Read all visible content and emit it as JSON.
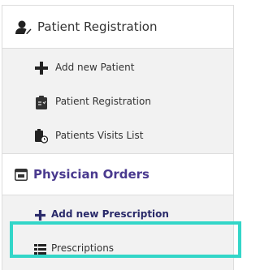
{
  "patient_registration": {
    "title": "Patient Registration",
    "icon": "user-icon",
    "items": [
      {
        "label": "Add new Patient",
        "icon": "plus-icon"
      },
      {
        "label": "Patient Registration",
        "icon": "clipboard-icon"
      },
      {
        "label": "Patients Visits List",
        "icon": "user-clock-icon"
      }
    ]
  },
  "physician_orders": {
    "title": "Physician Orders",
    "icon": "window-icon",
    "items": [
      {
        "label": "Add new Prescription",
        "icon": "plus-icon"
      },
      {
        "label": "Prescriptions",
        "icon": "list-icon"
      }
    ]
  },
  "colors": {
    "header_accent": "#4a3a8f",
    "highlight": "#33d6c8",
    "submenu_bg": "#f2f2f2"
  }
}
